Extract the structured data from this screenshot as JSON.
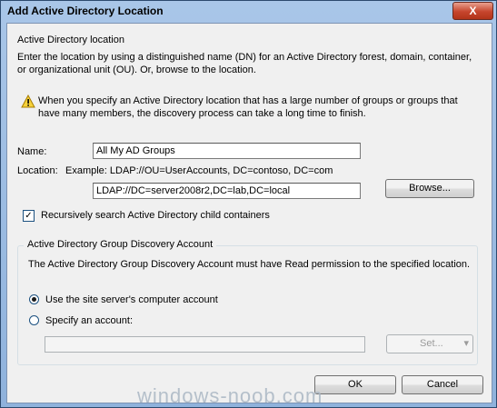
{
  "window": {
    "title": "Add Active Directory Location",
    "close_glyph": "X"
  },
  "ad_location": {
    "group_title": "Active Directory location",
    "description": "Enter the location by using a distinguished name (DN) for an Active Directory forest, domain, container, or organizational unit (OU). Or, browse to the location.",
    "warning": "When you specify an Active Directory location that has a large number of groups or groups that have many members, the discovery process can take a long time to finish.",
    "name_label": "Name:",
    "name_value": "All My AD Groups",
    "location_label": "Location:",
    "location_example": "Example: LDAP://OU=UserAccounts, DC=contoso, DC=com",
    "location_value": "LDAP://DC=server2008r2,DC=lab,DC=local",
    "browse_label": "Browse...",
    "recursive_label": "Recursively search Active Directory child containers",
    "recursive_checked": true
  },
  "account": {
    "group_title": "Active Directory Group Discovery Account",
    "description": "The Active Directory Group Discovery Account must have Read permission to the specified location.",
    "option_site": "Use the site server's computer account",
    "option_specify": "Specify an account:",
    "selected": "site",
    "account_value": "",
    "set_label": "Set...",
    "set_arrow": "▾"
  },
  "buttons": {
    "ok": "OK",
    "cancel": "Cancel"
  },
  "watermark": "windows-noob.com"
}
